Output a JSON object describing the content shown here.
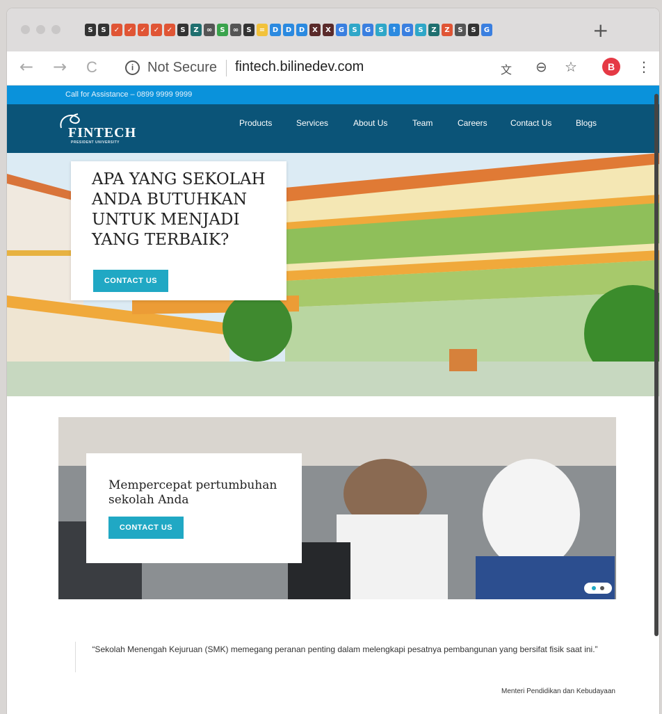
{
  "browser": {
    "new_tab_symbol": "+",
    "tab_favicons": [
      "S",
      "S",
      "✓",
      "✓",
      "✓",
      "✓",
      "✓",
      "S",
      "Z",
      "∞",
      "S",
      "∞",
      "S",
      "=",
      "D",
      "D",
      "D",
      "X",
      "X",
      "G",
      "S",
      "G",
      "S",
      "↑",
      "G",
      "S",
      "Z",
      "Z",
      "S",
      "S",
      "G"
    ],
    "back_symbol": "←",
    "forward_symbol": "→",
    "reload_symbol": "C",
    "info_symbol": "i",
    "security_label": "Not Secure",
    "url": "fintech.bilinedev.com",
    "translate_symbol": "文",
    "zoom_symbol": "⊖",
    "bookmark_symbol": "☆",
    "profile_initial": "B",
    "menu_symbol": "⋮"
  },
  "site": {
    "assistance_text": "Call for Assistance – 0899 9999 9999",
    "logo_text": "FINTECH",
    "logo_subtitle": "PRESIDENT UNIVERSITY",
    "nav": [
      "Products",
      "Services",
      "About Us",
      "Team",
      "Careers",
      "Contact Us",
      "Blogs"
    ],
    "hero": {
      "title": "APA YANG SEKOLAH ANDA BUTUHKAN UNTUK MENJADI YANG TERBAIK?",
      "button": "CONTACT US"
    },
    "slider": {
      "title": "Mempercepat pertumbuhan sekolah Anda",
      "button": "CONTACT US"
    },
    "quote": {
      "text": "“Sekolah Menengah Kejuruan (SMK) memegang peranan penting dalam melengkapi pesatnya pembangunan yang bersifat fisik saat ini.”",
      "author": "Menteri Pendidikan dan Kebudayaan"
    }
  },
  "colors": {
    "assistance_bar": "#0a92db",
    "nav_bar": "#0b5478",
    "button": "#20a8c4",
    "profile": "#e53945"
  }
}
